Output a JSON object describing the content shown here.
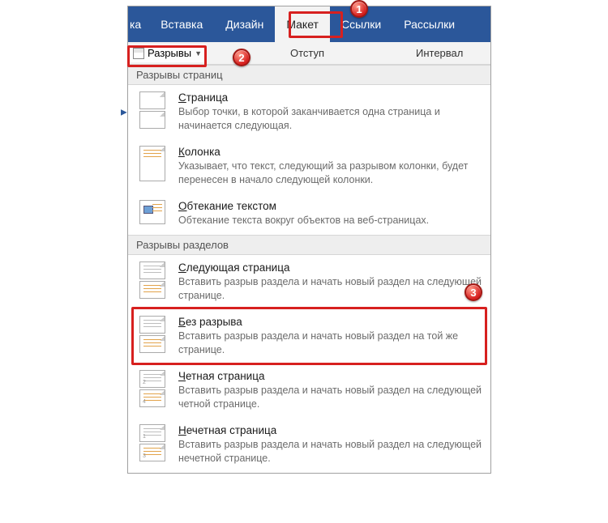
{
  "ribbon": {
    "tabs": [
      "ка",
      "Вставка",
      "Дизайн",
      "Макет",
      "Ссылки",
      "Рассылки"
    ],
    "active_index": 3
  },
  "subbar": {
    "breaks_label": "Разрывы",
    "indent_label": "Отступ",
    "interval_label": "Интервал"
  },
  "sections": [
    {
      "header": "Разрывы страниц",
      "items": [
        {
          "title_u": "С",
          "title_rest": "траница",
          "desc": "Выбор точки, в которой заканчивается одна страница и начинается следующая."
        },
        {
          "title_u": "К",
          "title_rest": "олонка",
          "desc": "Указывает, что текст, следующий за разрывом колонки, будет перенесен в начало следующей колонки."
        },
        {
          "title_u": "О",
          "title_rest": "бтекание текстом",
          "desc": "Обтекание текста вокруг объектов на веб-страницах."
        }
      ]
    },
    {
      "header": "Разрывы разделов",
      "items": [
        {
          "title_u": "С",
          "title_rest": "ледующая страница",
          "desc": "Вставить разрыв раздела и начать новый раздел на следующей странице."
        },
        {
          "title_u": "Б",
          "title_rest": "ез разрыва",
          "desc": "Вставить разрыв раздела и начать новый раздел на той же странице."
        },
        {
          "title_u": "Ч",
          "title_rest": "етная страница",
          "desc": "Вставить разрыв раздела и начать новый раздел на следующей четной странице."
        },
        {
          "title_u": "Н",
          "title_rest": "ечетная страница",
          "desc": "Вставить разрыв раздела и начать новый раздел на следующей нечетной странице."
        }
      ]
    }
  ],
  "badges": {
    "b1": "1",
    "b2": "2",
    "b3": "3"
  }
}
